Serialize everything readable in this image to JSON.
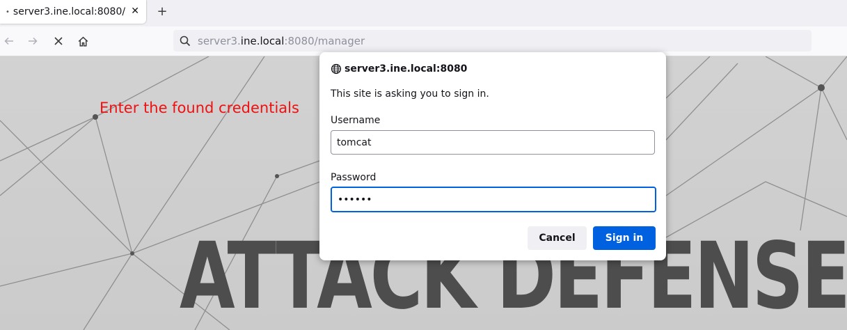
{
  "browser": {
    "tab": {
      "title": "server3.ine.local:8080/",
      "close_glyph": "✕",
      "loading_dot": "•"
    },
    "new_tab_glyph": "+",
    "url": {
      "host_prefix": "server3.",
      "host_main": "ine.local",
      "rest": ":8080/manager"
    },
    "icons": [
      "back-arrow-icon",
      "forward-arrow-icon",
      "stop-icon",
      "home-icon",
      "search-icon"
    ]
  },
  "page": {
    "annotation": "Enter the found credentials",
    "banner": "ATTACK DEFENSE"
  },
  "dialog": {
    "origin": "server3.ine.local:8080",
    "message": "This site is asking you to sign in.",
    "username_label": "Username",
    "username_value": "tomcat",
    "password_label": "Password",
    "password_value": "••••••",
    "cancel_label": "Cancel",
    "signin_label": "Sign in"
  },
  "colors": {
    "accent": "#0061e0",
    "annotation": "#ee1111"
  }
}
